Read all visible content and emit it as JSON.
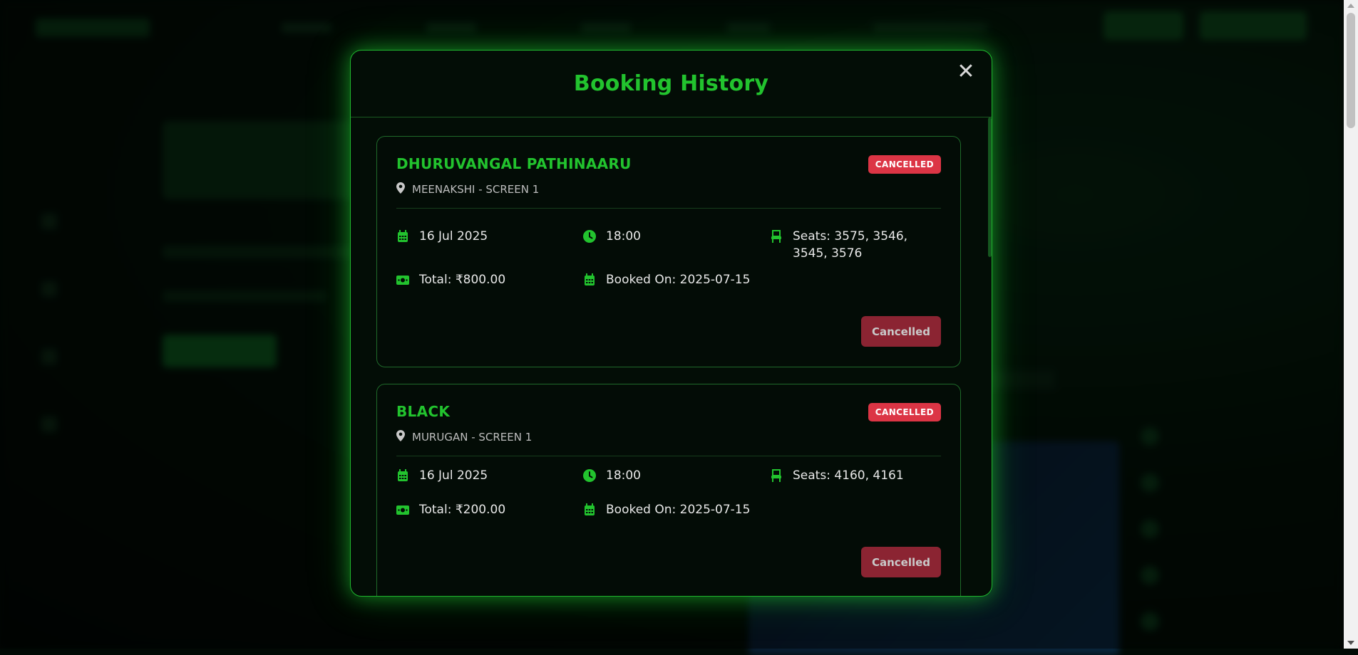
{
  "modal": {
    "title": "Booking History",
    "close_symbol": "✕"
  },
  "bookings": [
    {
      "movie": "DHURUVANGAL PATHINAARU",
      "status_badge": "CANCELLED",
      "venue": "MEENAKSHI - SCREEN 1",
      "date": "16 Jul 2025",
      "time": "18:00",
      "seats": "Seats: 3575, 3546, 3545, 3576",
      "total": "Total: ₹800.00",
      "booked_on": "Booked On: 2025-07-15",
      "action_label": "Cancelled"
    },
    {
      "movie": "BLACK",
      "status_badge": "CANCELLED",
      "venue": "MURUGAN - SCREEN 1",
      "date": "16 Jul 2025",
      "time": "18:00",
      "seats": "Seats: 4160, 4161",
      "total": "Total: ₹200.00",
      "booked_on": "Booked On: 2025-07-15",
      "action_label": "Cancelled"
    }
  ],
  "icons": {
    "location": "map-pin-icon",
    "date": "calendar-icon",
    "time": "clock-icon",
    "seats": "seat-icon",
    "total": "money-icon",
    "booked_on": "calendar-icon",
    "close": "close-icon"
  },
  "colors": {
    "accent": "#22c32e",
    "badge_red": "#dc3545",
    "button_disabled_red": "#8b2432",
    "modal_background": "#030d06"
  }
}
